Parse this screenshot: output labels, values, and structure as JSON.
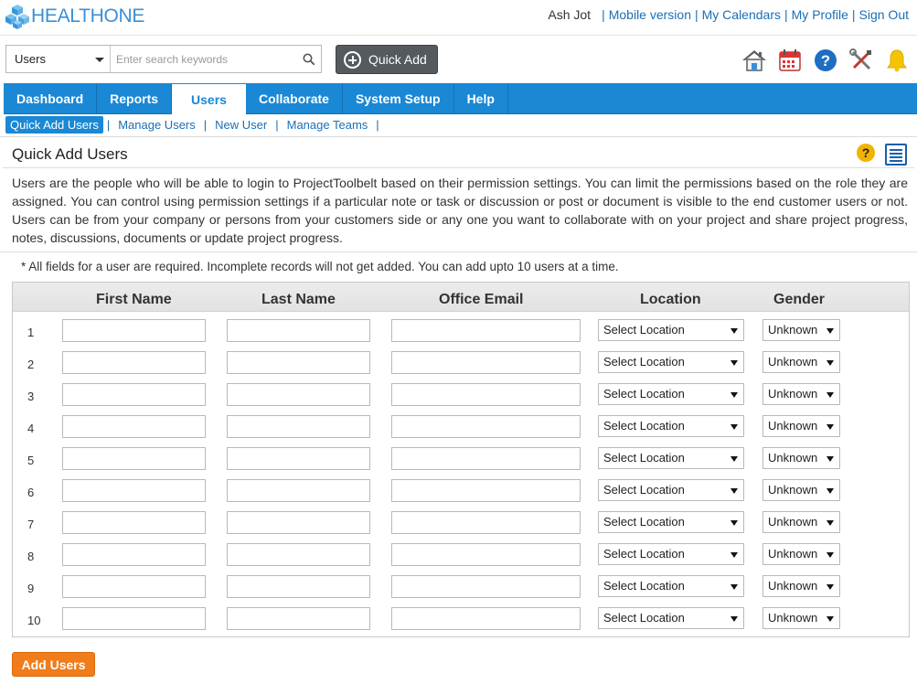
{
  "brand": {
    "logo_text_a": "HEALTH",
    "logo_text_b": "ONE"
  },
  "header": {
    "user_name": "Ash Jot",
    "links": [
      "Mobile version",
      "My Calendars",
      "My Profile",
      "Sign Out"
    ]
  },
  "search": {
    "scope": "Users",
    "placeholder": "Enter search keywords"
  },
  "quick_add_label": "Quick Add",
  "nav": {
    "tabs": [
      "Dashboard",
      "Reports",
      "Users",
      "Collaborate",
      "System Setup",
      "Help"
    ],
    "active_tab": "Users"
  },
  "subnav": {
    "items": [
      "Quick Add Users",
      "Manage Users",
      "New User",
      "Manage Teams"
    ],
    "active": "Quick Add Users"
  },
  "page": {
    "title": "Quick Add Users",
    "description": "Users are the people who will be able to login to ProjectToolbelt based on their permission settings. You can limit the permissions based on the role they are assigned. You can control using permission settings if a particular note or task or discussion or post or document is visible to the end customer users or not. Users can be from your company or persons from your customers side or any one you want to collaborate with on your project and share project progress, notes, discussions, documents or update project progress.",
    "note": "* All fields for a user are required. Incomplete records will not get added. You can add upto 10 users at a time."
  },
  "grid": {
    "columns": [
      "First Name",
      "Last Name",
      "Office Email",
      "Location",
      "Gender"
    ],
    "location_default": "Select Location",
    "gender_default": "Unknown",
    "rows": [
      "1",
      "2",
      "3",
      "4",
      "5",
      "6",
      "7",
      "8",
      "9",
      "10"
    ]
  },
  "submit_label": "Add Users",
  "icons": [
    "home-icon",
    "calendar-icon",
    "help-icon",
    "tools-icon",
    "notification-bell-icon",
    "help-icon",
    "list-view-icon",
    "search-icon",
    "plus-circle-icon"
  ],
  "colors": {
    "nav_blue": "#1a88d4",
    "link_blue": "#1a6fb6",
    "submit_orange": "#f07d1a"
  }
}
